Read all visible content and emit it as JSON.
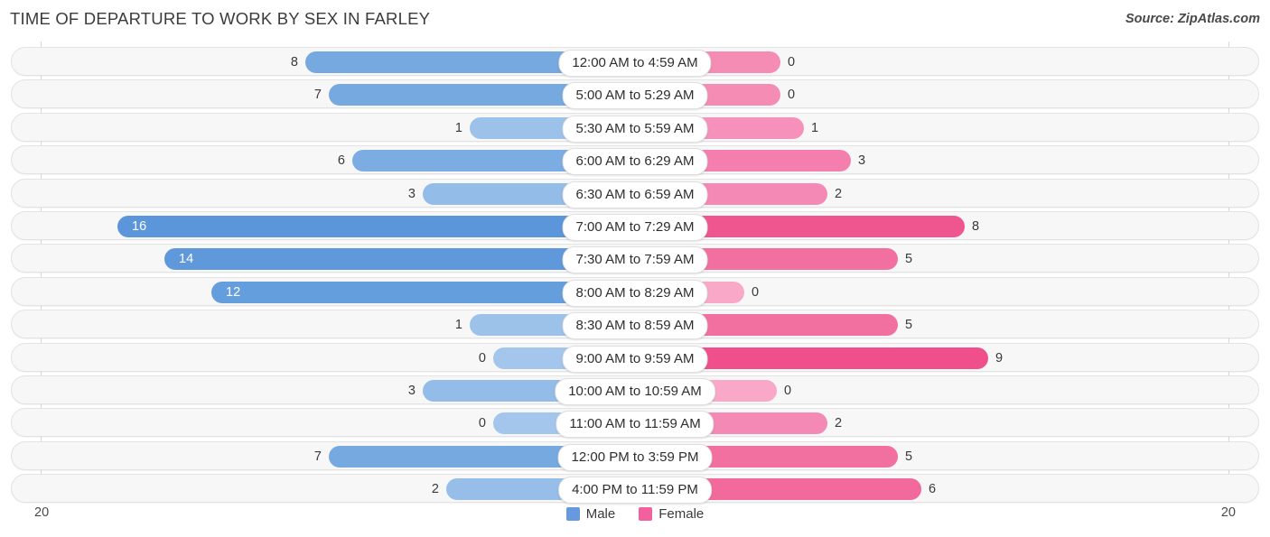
{
  "header": {
    "title": "TIME OF DEPARTURE TO WORK BY SEX IN FARLEY",
    "source": "Source: ZipAtlas.com"
  },
  "axis": {
    "left_end": "20",
    "right_end": "20"
  },
  "legend": [
    {
      "label": "Male",
      "color": "#6699dd"
    },
    {
      "label": "Female",
      "color": "#f2609e"
    }
  ],
  "chart_data": {
    "type": "bar",
    "title": "TIME OF DEPARTURE TO WORK BY SEX IN FARLEY",
    "orientation": "horizontal-diverging",
    "xlabel": "",
    "ylabel": "",
    "axis_max": 20,
    "categories": [
      "12:00 AM to 4:59 AM",
      "5:00 AM to 5:29 AM",
      "5:30 AM to 5:59 AM",
      "6:00 AM to 6:29 AM",
      "6:30 AM to 6:59 AM",
      "7:00 AM to 7:29 AM",
      "7:30 AM to 7:59 AM",
      "8:00 AM to 8:29 AM",
      "8:30 AM to 8:59 AM",
      "9:00 AM to 9:59 AM",
      "10:00 AM to 10:59 AM",
      "11:00 AM to 11:59 AM",
      "12:00 PM to 3:59 PM",
      "4:00 PM to 11:59 PM"
    ],
    "series": [
      {
        "name": "Male",
        "direction": "left",
        "values": [
          8,
          7,
          1,
          6,
          3,
          16,
          14,
          12,
          1,
          0,
          3,
          0,
          7,
          2
        ]
      },
      {
        "name": "Female",
        "direction": "right",
        "values": [
          0,
          0,
          1,
          3,
          2,
          8,
          5,
          0,
          5,
          9,
          0,
          2,
          5,
          6
        ]
      }
    ]
  },
  "rows": [
    {
      "label": "12:00 AM to 4:59 AM",
      "male": "8",
      "female": "0",
      "male_len": 364,
      "female_len": 160,
      "male_color": "#76a9e0",
      "female_color": "#f58cb4",
      "male_inside": false,
      "female_inside": false
    },
    {
      "label": "5:00 AM to 5:29 AM",
      "male": "7",
      "female": "0",
      "male_len": 338,
      "female_len": 160,
      "male_color": "#76a9e0",
      "female_color": "#f58cb4",
      "male_inside": false,
      "female_inside": false
    },
    {
      "label": "5:30 AM to 5:59 AM",
      "male": "1",
      "female": "1",
      "male_len": 182,
      "female_len": 186,
      "male_color": "#9dc2ea",
      "female_color": "#f691bc",
      "male_inside": false,
      "female_inside": false
    },
    {
      "label": "6:00 AM to 6:29 AM",
      "male": "6",
      "female": "3",
      "male_len": 312,
      "female_len": 238,
      "male_color": "#7cade2",
      "female_color": "#f47fae",
      "male_inside": false,
      "female_inside": false
    },
    {
      "label": "6:30 AM to 6:59 AM",
      "male": "3",
      "female": "2",
      "male_len": 234,
      "female_len": 212,
      "male_color": "#93bce8",
      "female_color": "#f589b6",
      "male_inside": false,
      "female_inside": false
    },
    {
      "label": "7:00 AM to 7:29 AM",
      "male": "16",
      "female": "8",
      "male_len": 572,
      "female_len": 364,
      "male_color": "#5b96da",
      "female_color": "#ef5690",
      "male_inside": true,
      "female_inside": false
    },
    {
      "label": "7:30 AM to 7:59 AM",
      "male": "14",
      "female": "5",
      "male_len": 520,
      "female_len": 290,
      "male_color": "#6099db",
      "female_color": "#f2709f",
      "male_inside": true,
      "female_inside": false
    },
    {
      "label": "8:00 AM to 8:29 AM",
      "male": "12",
      "female": "0",
      "male_len": 468,
      "female_len": 120,
      "male_color": "#659edc",
      "female_color": "#f9a8c8",
      "male_inside": true,
      "female_inside": false
    },
    {
      "label": "8:30 AM to 8:59 AM",
      "male": "1",
      "female": "5",
      "male_len": 182,
      "female_len": 290,
      "male_color": "#9dc2ea",
      "female_color": "#f2709f",
      "male_inside": false,
      "female_inside": false
    },
    {
      "label": "9:00 AM to 9:59 AM",
      "male": "0",
      "female": "9",
      "male_len": 156,
      "female_len": 390,
      "male_color": "#a4c6ec",
      "female_color": "#ef4f8b",
      "male_inside": false,
      "female_inside": false
    },
    {
      "label": "10:00 AM to 10:59 AM",
      "male": "3",
      "female": "0",
      "male_len": 234,
      "female_len": 156,
      "male_color": "#93bce8",
      "female_color": "#f9a8c8",
      "male_inside": false,
      "female_inside": false
    },
    {
      "label": "11:00 AM to 11:59 AM",
      "male": "0",
      "female": "2",
      "male_len": 156,
      "female_len": 212,
      "male_color": "#a4c6ec",
      "female_color": "#f589b6",
      "male_inside": false,
      "female_inside": false
    },
    {
      "label": "12:00 PM to 3:59 PM",
      "male": "7",
      "female": "5",
      "male_len": 338,
      "female_len": 290,
      "male_color": "#76a9e0",
      "female_color": "#f2709f",
      "male_inside": false,
      "female_inside": false
    },
    {
      "label": "4:00 PM to 11:59 PM",
      "male": "2",
      "female": "6",
      "male_len": 208,
      "female_len": 316,
      "male_color": "#97bee9",
      "female_color": "#f26a9b",
      "male_inside": false,
      "female_inside": false
    }
  ]
}
